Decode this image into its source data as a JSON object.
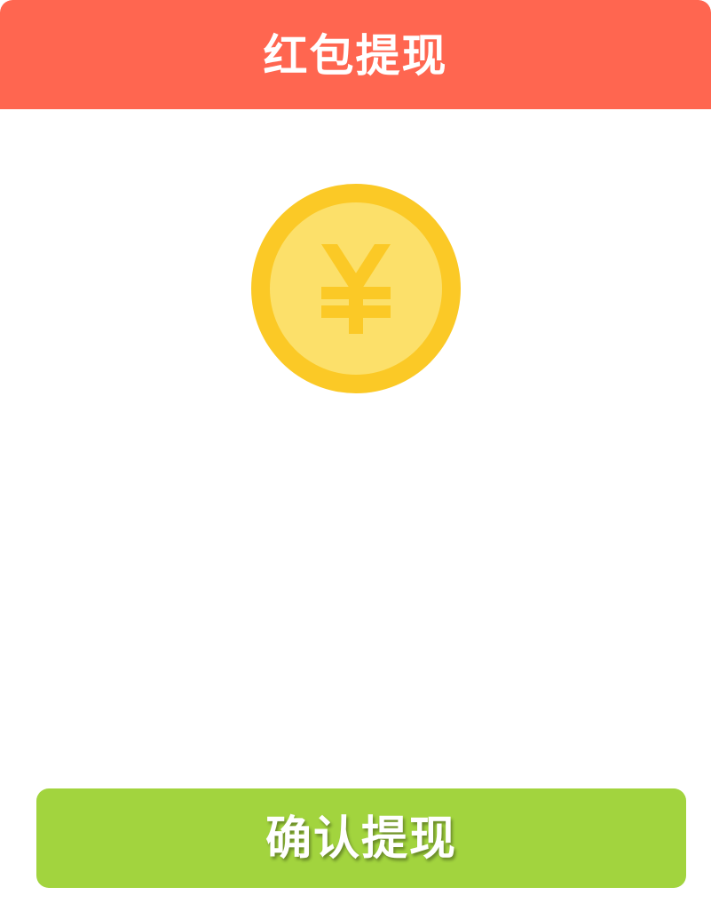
{
  "header": {
    "title": "红包提现"
  },
  "coin": {
    "icon": "yuan-coin-icon",
    "symbol": "¥"
  },
  "confirm_button": {
    "label": "确认提现"
  },
  "colors": {
    "header_bg": "#ff6650",
    "button_bg": "#a2d43e",
    "coin_outer": "#fbc926",
    "coin_inner": "#fce06a",
    "text_on_color": "#ffffff"
  }
}
